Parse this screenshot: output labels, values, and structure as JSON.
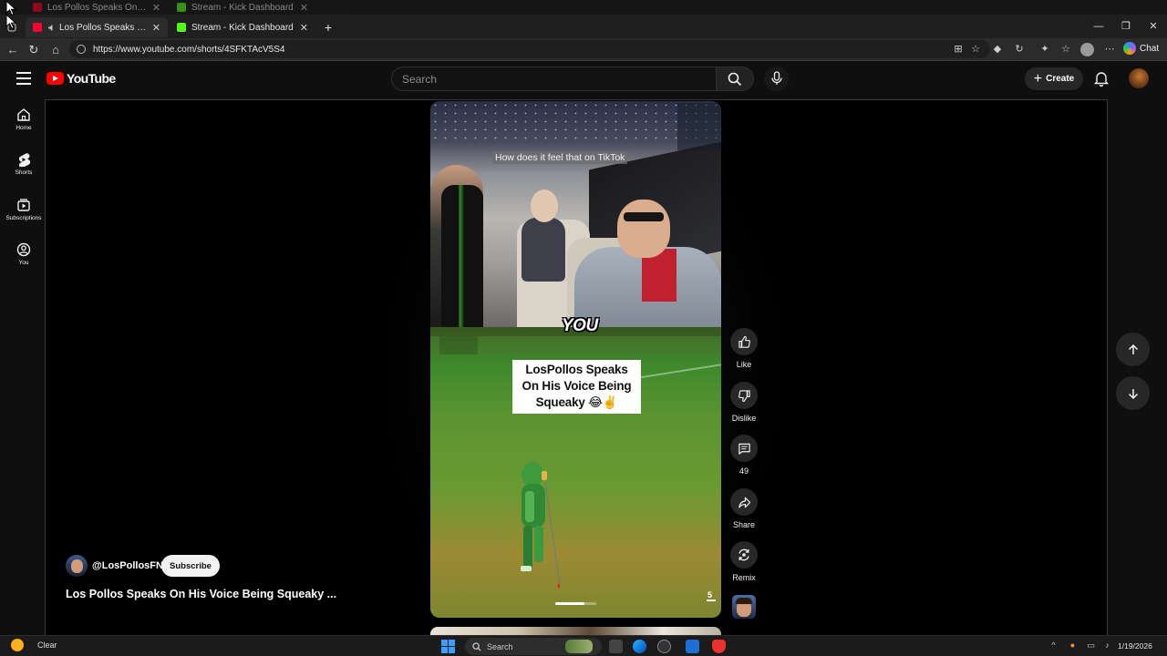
{
  "browser": {
    "tabs": [
      {
        "title": "Los Pollos Speaks On His Voic",
        "favicon_color": "#ff0033",
        "active": true
      },
      {
        "title": "Stream - Kick Dashboard",
        "favicon_color": "#53fc18",
        "active": false
      }
    ],
    "ghost_tabs": [
      {
        "title": "Los Pollos Speaks On His Voic"
      },
      {
        "title": "Stream - Kick Dashboard"
      }
    ],
    "new_tab_glyph": "+",
    "url": "https://www.youtube.com/shorts/4SFKTAcV5S4",
    "chat_label": "Chat"
  },
  "youtube": {
    "logo_text": "YouTube",
    "search_placeholder": "Search",
    "create_label": "Create",
    "guide": [
      {
        "label": "Home",
        "icon": "home-icon"
      },
      {
        "label": "Shorts",
        "icon": "shorts-icon"
      },
      {
        "label": "Subscriptions",
        "icon": "subscriptions-icon"
      },
      {
        "label": "You",
        "icon": "you-icon"
      }
    ]
  },
  "short": {
    "caption_overlay": "How does it feel that on TikTok",
    "caption_word": "YOU",
    "title_card": "LosPollos Speaks On His Voice Being Squeaky 😂✌️",
    "page_indicator": "5",
    "progress_fraction": 0.7,
    "channel_handle": "@LosPollosFN",
    "subscribe_label": "Subscribe",
    "title": "Los Pollos Speaks On His Voice Being Squeaky ..."
  },
  "actions": [
    {
      "label": "Like",
      "icon": "thumbs-up-icon"
    },
    {
      "label": "Dislike",
      "icon": "thumbs-down-icon"
    },
    {
      "label": "49",
      "icon": "comment-icon"
    },
    {
      "label": "Share",
      "icon": "share-icon"
    },
    {
      "label": "Remix",
      "icon": "remix-icon"
    }
  ],
  "taskbar": {
    "weather_label": "Clear",
    "search_label": "Search",
    "date": "1/19/2026"
  },
  "colors": {
    "brand_red": "#ff0000",
    "background": "#0f0f0f",
    "button_bg": "#272727"
  }
}
